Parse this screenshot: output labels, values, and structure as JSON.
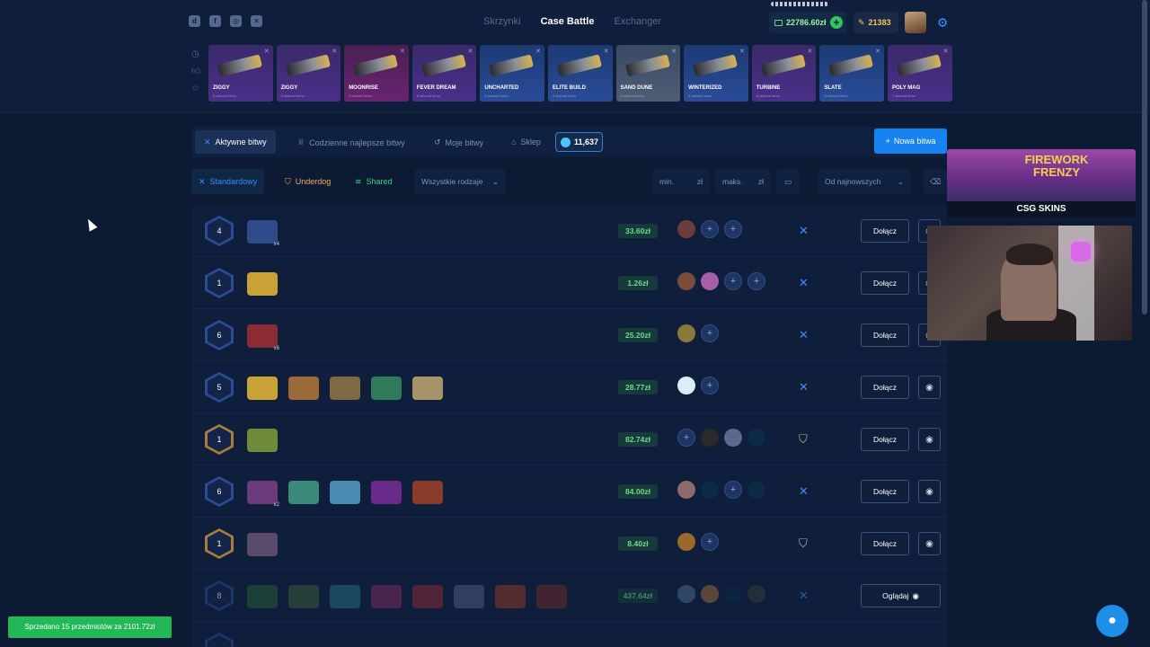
{
  "header": {
    "socials": [
      "discord-icon",
      "facebook-icon",
      "instagram-icon",
      "x-icon"
    ],
    "nav": [
      {
        "label": "Skrzynki",
        "active": false
      },
      {
        "label": "Case Battle",
        "active": true
      },
      {
        "label": "Exchanger",
        "active": false
      }
    ],
    "balance": "22786.60zł",
    "coins": "21383"
  },
  "drops": [
    {
      "name": "ZIGGY",
      "sub": "5 sekund temu",
      "color": "purple"
    },
    {
      "name": "ZIGGY",
      "sub": "5 sekund temu",
      "color": "purple"
    },
    {
      "name": "MOONRISE",
      "sub": "5 sekund temu",
      "color": "pink"
    },
    {
      "name": "FEVER DREAM",
      "sub": "6 sekund temu",
      "color": "purple"
    },
    {
      "name": "UNCHARTED",
      "sub": "5 sekund temu",
      "color": "blue"
    },
    {
      "name": "ELITE BUILD",
      "sub": "5 sekund temu",
      "color": "blue"
    },
    {
      "name": "SAND DUNE",
      "sub": "6 sekund temu",
      "color": "gray"
    },
    {
      "name": "WINTERIZED",
      "sub": "6 sekund temu",
      "color": "blue"
    },
    {
      "name": "TURBINE",
      "sub": "6 sekund temu",
      "color": "purple"
    },
    {
      "name": "SLATE",
      "sub": "6 sekund temu",
      "color": "blue"
    },
    {
      "name": "POLY MAG",
      "sub": "7 sekund temu",
      "color": "purple"
    }
  ],
  "tabs": {
    "active": "Aktywne bitwy",
    "daily": "Codzienne najlepsze bitwy",
    "mine": "Moje bitwy",
    "shop": "Sklep",
    "gems": "11,637",
    "new_battle": "Nowa bitwa"
  },
  "filters": {
    "standard": "Standardowy",
    "underdog": "Underdog",
    "shared": "Shared",
    "all_types": "Wszystkie rodzaje",
    "min": "min.",
    "max": "maks.",
    "currency": "zł",
    "sort": "Od najnowszych"
  },
  "battles": [
    {
      "rounds": "4",
      "price": "33.60zł",
      "mode": "standard",
      "button": "Dołącz",
      "cases": [
        [
          "#2f4b8a",
          "x4"
        ]
      ],
      "players": [
        "#6b3d3d",
        "slot",
        "slot"
      ],
      "dim": false,
      "gold": false
    },
    {
      "rounds": "1",
      "price": "1.26zł",
      "mode": "standard",
      "button": "Dołącz",
      "cases": [
        [
          "#c8a236",
          ""
        ]
      ],
      "players": [
        "#7a4a3a",
        "#a65fa8",
        "slot",
        "slot"
      ],
      "dim": false,
      "gold": false
    },
    {
      "rounds": "6",
      "price": "25.20zł",
      "mode": "standard",
      "button": "Dołącz",
      "cases": [
        [
          "#8a2b35",
          "x6"
        ]
      ],
      "players": [
        "#8a7a3a",
        "slot"
      ],
      "dim": false,
      "gold": false
    },
    {
      "rounds": "5",
      "price": "28.77zł",
      "mode": "standard",
      "button": "Dołącz",
      "cases": [
        [
          "#c8a236",
          ""
        ],
        [
          "#9a6a3a",
          ""
        ],
        [
          "#7d6a45",
          ""
        ],
        [
          "#2f7a5a",
          ""
        ],
        [
          "#a8946a",
          ""
        ]
      ],
      "players": [
        "#d9eef9",
        "slot"
      ],
      "dim": false,
      "gold": false
    },
    {
      "rounds": "1",
      "price": "82.74zł",
      "mode": "underdog",
      "button": "Dołącz",
      "cases": [
        [
          "#6e8a3a",
          ""
        ]
      ],
      "players": [
        "slot",
        "#2a2a2a",
        "#5a6a8a",
        "#0b2a45"
      ],
      "dim": false,
      "gold": true
    },
    {
      "rounds": "6",
      "price": "84.00zł",
      "mode": "standard",
      "button": "Dołącz",
      "cases": [
        [
          "#6a3a7a",
          "x2"
        ],
        [
          "#3a8a7a",
          ""
        ],
        [
          "#4a8ab0",
          ""
        ],
        [
          "#6a2a8a",
          ""
        ],
        [
          "#8a3a2a",
          ""
        ]
      ],
      "players": [
        "#8a6a6a",
        "#0b2a45",
        "slot",
        "#0b2a45"
      ],
      "dim": false,
      "gold": false
    },
    {
      "rounds": "1",
      "price": "8.40zł",
      "mode": "underdog",
      "button": "Dołącz",
      "cases": [
        [
          "#5a4a6a",
          ""
        ]
      ],
      "players": [
        "#9a6a2a",
        "slot"
      ],
      "dim": false,
      "gold": true
    },
    {
      "rounds": "8",
      "price": "437.64zł",
      "mode": "standard",
      "button": "Oglądaj",
      "cases": [
        [
          "#2a5a3a",
          ""
        ],
        [
          "#3a5a3a",
          ""
        ],
        [
          "#2a6a7a",
          ""
        ],
        [
          "#7a2a5a",
          ""
        ],
        [
          "#8a2a3a",
          ""
        ],
        [
          "#4a5a7a",
          ""
        ],
        [
          "#8a3a2a",
          ""
        ],
        [
          "#6a2a2a",
          ""
        ]
      ],
      "players": [
        "#4a6a8a",
        "#9a6a3a",
        "#0b2a45",
        "#3a3a3a"
      ],
      "dim": true,
      "gold": false
    }
  ],
  "toast": "Sprzedano 15 przedmiotów za 2101.72zł",
  "ad": {
    "title": "FIREWORK FRENZY",
    "brand": "CSG SKINS"
  }
}
